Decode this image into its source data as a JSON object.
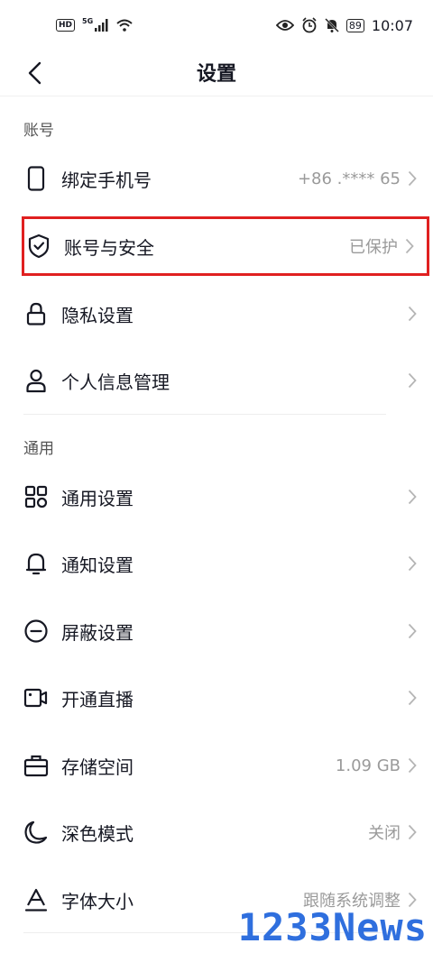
{
  "status_bar": {
    "hd": "HD",
    "network": "5G",
    "battery": "89",
    "time": "10:07"
  },
  "header": {
    "title": "设置"
  },
  "sections": {
    "account": {
      "title": "账号",
      "items": [
        {
          "label": "绑定手机号",
          "value": "+86 .**** 65",
          "icon": "phone-icon"
        },
        {
          "label": "账号与安全",
          "value": "已保护",
          "icon": "shield-check-icon"
        },
        {
          "label": "隐私设置",
          "value": "",
          "icon": "lock-icon"
        },
        {
          "label": "个人信息管理",
          "value": "",
          "icon": "person-icon"
        }
      ]
    },
    "general": {
      "title": "通用",
      "items": [
        {
          "label": "通用设置",
          "value": "",
          "icon": "grid-icon"
        },
        {
          "label": "通知设置",
          "value": "",
          "icon": "bell-icon"
        },
        {
          "label": "屏蔽设置",
          "value": "",
          "icon": "block-icon"
        },
        {
          "label": "开通直播",
          "value": "",
          "icon": "video-icon"
        },
        {
          "label": "存储空间",
          "value": "1.09 GB",
          "icon": "briefcase-icon"
        },
        {
          "label": "深色模式",
          "value": "关闭",
          "icon": "moon-icon"
        },
        {
          "label": "字体大小",
          "value": "跟随系统调整",
          "icon": "font-icon"
        }
      ]
    }
  },
  "watermark": "1233News",
  "colors": {
    "highlight": "#e02020",
    "watermark": "#2f6fde"
  }
}
